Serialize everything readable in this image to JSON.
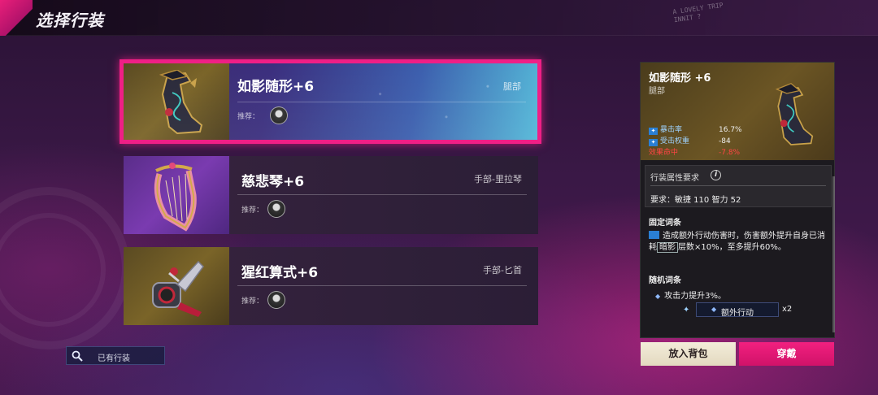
{
  "header": {
    "title": "选择行装",
    "scribble_line1": "A LOVELY TRIP",
    "scribble_line2": "INNIT ?"
  },
  "items": [
    {
      "name": "如影随形+6",
      "slot": "腿部",
      "recommend_label": "推荐：",
      "selected": true,
      "icon": "boot-icon"
    },
    {
      "name": "慈悲琴+6",
      "slot": "手部-里拉琴",
      "recommend_label": "推荐：",
      "selected": false,
      "icon": "lyre-icon"
    },
    {
      "name": "猩红算式+6",
      "slot": "手部-匕首",
      "recommend_label": "推荐：",
      "selected": false,
      "icon": "gauntlet-icon"
    }
  ],
  "search": {
    "label": "已有行装",
    "icon": "search-icon"
  },
  "detail": {
    "title": "如影随形  +6",
    "slot": "腿部",
    "stats": [
      {
        "label": "暴击率",
        "value": "16.7%",
        "negative": false
      },
      {
        "label": "受击权重",
        "value": "-84",
        "negative": false
      },
      {
        "label": "效果命中",
        "value": "-7.8%",
        "negative": true
      }
    ],
    "requirement_title": "行装属性要求",
    "requirement_text": "要求：敏捷 110 智力 52",
    "fixed_title": "固定词条",
    "fixed_text_a": "造成额外行动伤害时，伤害额外提升自身已消耗",
    "fixed_keyword": "暗影",
    "fixed_text_b": "层数×10%，至多提升60%。",
    "random_title": "随机词条",
    "random_1": "攻击力提升3%。",
    "random_2": "额外行动",
    "random_2_mult": "x2"
  },
  "buttons": {
    "add_to_bag": "放入背包",
    "equip": "穿戴"
  },
  "colors": {
    "accent": "#ef1f86",
    "stat_label": "#9fd3ff",
    "negative": "#ff4545"
  }
}
